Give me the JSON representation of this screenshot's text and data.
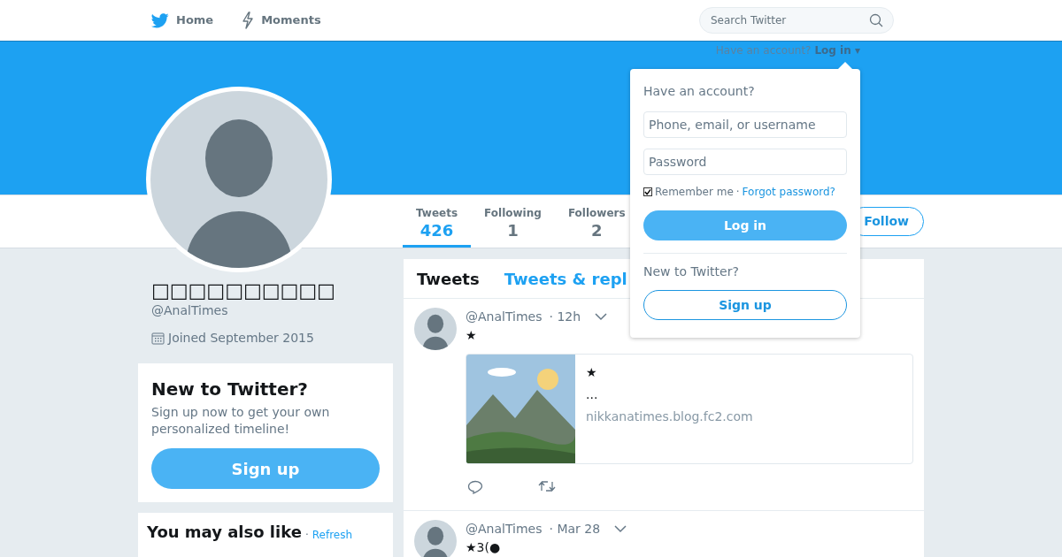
{
  "nav": {
    "items": [
      {
        "kind": "bird",
        "label": "Home"
      },
      {
        "kind": "bolt",
        "label": "Moments"
      }
    ],
    "search": {
      "placeholder": "Search Twitter"
    }
  },
  "banner": {
    "prompt": "Have an account?",
    "login": "Log in",
    "caret": "▾"
  },
  "stats": [
    {
      "label": "Tweets",
      "value": "426",
      "selected": true
    },
    {
      "label": "Following",
      "value": "1",
      "selected": false
    },
    {
      "label": "Followers",
      "value": "2",
      "selected": false
    }
  ],
  "follow_button": "Follow",
  "profile": {
    "name": "□□□□□□□□□□",
    "handle": "@AnalTimes",
    "joined": "Joined September 2015"
  },
  "signup_card": {
    "title": "New to Twitter?",
    "text": "Sign up now to get your own personalized timeline!",
    "button": "Sign up"
  },
  "suggestions": {
    "title": "You may also like",
    "separator": "·",
    "refresh": "Refresh"
  },
  "timeline_tabs": [
    {
      "label": "Tweets",
      "selected": true
    },
    {
      "label": "Tweets & repl",
      "selected": false
    }
  ],
  "tweets": [
    {
      "handle": "@AnalTimes",
      "time": "· 12h",
      "text": "★",
      "card": {
        "kind": "picture",
        "title": "★",
        "description": "...",
        "domain": "nikkanatimes.blog.fc2.com"
      }
    },
    {
      "handle": "@AnalTimes",
      "time": "· Mar 28",
      "text": "★3(●"
    }
  ],
  "login_dropdown": {
    "title": "Have an account?",
    "username_placeholder": "Phone, email, or username",
    "password_placeholder": "Password",
    "remember": {
      "label": "Remember me",
      "checked": true
    },
    "separator": "·",
    "forgot": "Forgot password?",
    "login_button": "Log in",
    "new_title": "New to Twitter?",
    "signup_button": "Sign up"
  }
}
